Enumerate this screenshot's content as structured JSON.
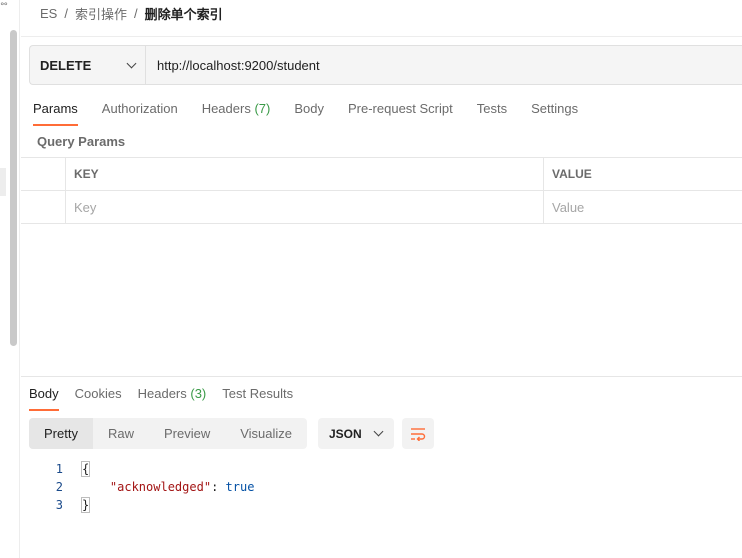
{
  "gutter": {
    "glyph": "°°"
  },
  "breadcrumb": {
    "items": [
      "ES",
      "索引操作"
    ],
    "separator": "/",
    "current": "删除单个索引"
  },
  "request": {
    "method": "DELETE",
    "url": "http://localhost:9200/student"
  },
  "request_tabs": [
    {
      "label": "Params",
      "active": true
    },
    {
      "label": "Authorization"
    },
    {
      "label": "Headers",
      "count": "(7)"
    },
    {
      "label": "Body"
    },
    {
      "label": "Pre-request Script"
    },
    {
      "label": "Tests"
    },
    {
      "label": "Settings"
    }
  ],
  "query_params": {
    "title": "Query Params",
    "columns": [
      "KEY",
      "VALUE"
    ],
    "placeholders": {
      "key": "Key",
      "value": "Value"
    }
  },
  "response_tabs": [
    {
      "label": "Body",
      "active": true
    },
    {
      "label": "Cookies"
    },
    {
      "label": "Headers",
      "count": "(3)"
    },
    {
      "label": "Test Results"
    }
  ],
  "format_buttons": [
    "Pretty",
    "Raw",
    "Preview",
    "Visualize"
  ],
  "language": "JSON",
  "wrap_icon": "wrap-lines-icon",
  "response_body": {
    "line_numbers": [
      "1",
      "2",
      "3"
    ],
    "open_brace": "{",
    "key": "\"acknowledged\"",
    "colon": ": ",
    "value": "true",
    "close_brace": "}"
  },
  "colors": {
    "accent": "#ff6c37",
    "count_green": "#3a9a47",
    "json_key": "#a31515",
    "json_value": "#0451a5"
  }
}
